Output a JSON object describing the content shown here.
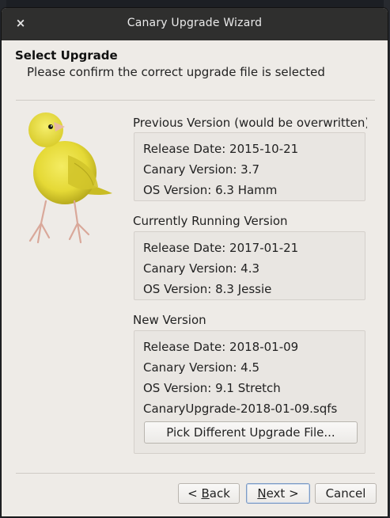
{
  "window": {
    "title": "Canary Upgrade Wizard",
    "close_glyph": "×"
  },
  "header": {
    "title": "Select Upgrade",
    "subtitle": "Please confirm the correct upgrade file is selected"
  },
  "sections": {
    "previous": {
      "label": "Previous Version (would be overwritten)",
      "release_date": "Release Date: 2015-10-21",
      "canary_version": "Canary Version: 3.7",
      "os_version": "OS Version: 6.3 Hamm"
    },
    "current": {
      "label": "Currently Running Version",
      "release_date": "Release Date: 2017-01-21",
      "canary_version": "Canary Version: 4.3",
      "os_version": "OS Version: 8.3 Jessie"
    },
    "new": {
      "label": "New Version",
      "release_date": "Release Date: 2018-01-09",
      "canary_version": "Canary Version: 4.5",
      "os_version": "OS Version: 9.1 Stretch",
      "filename": "CanaryUpgrade-2018-01-09.sqfs",
      "pick_button": "Pick Different Upgrade File..."
    }
  },
  "buttons": {
    "back_prefix": "< ",
    "back_mnemonic": "B",
    "back_rest": "ack",
    "next_mnemonic": "N",
    "next_rest": "ext >",
    "cancel": "Cancel"
  },
  "colors": {
    "titlebar": "#2f2f2e",
    "window_bg": "#eeebe7",
    "bird_yellow": "#e9de3c",
    "default_button_border": "#7d9bc4"
  },
  "icons": {
    "close": "close-icon",
    "bird": "canary-bird-image"
  }
}
